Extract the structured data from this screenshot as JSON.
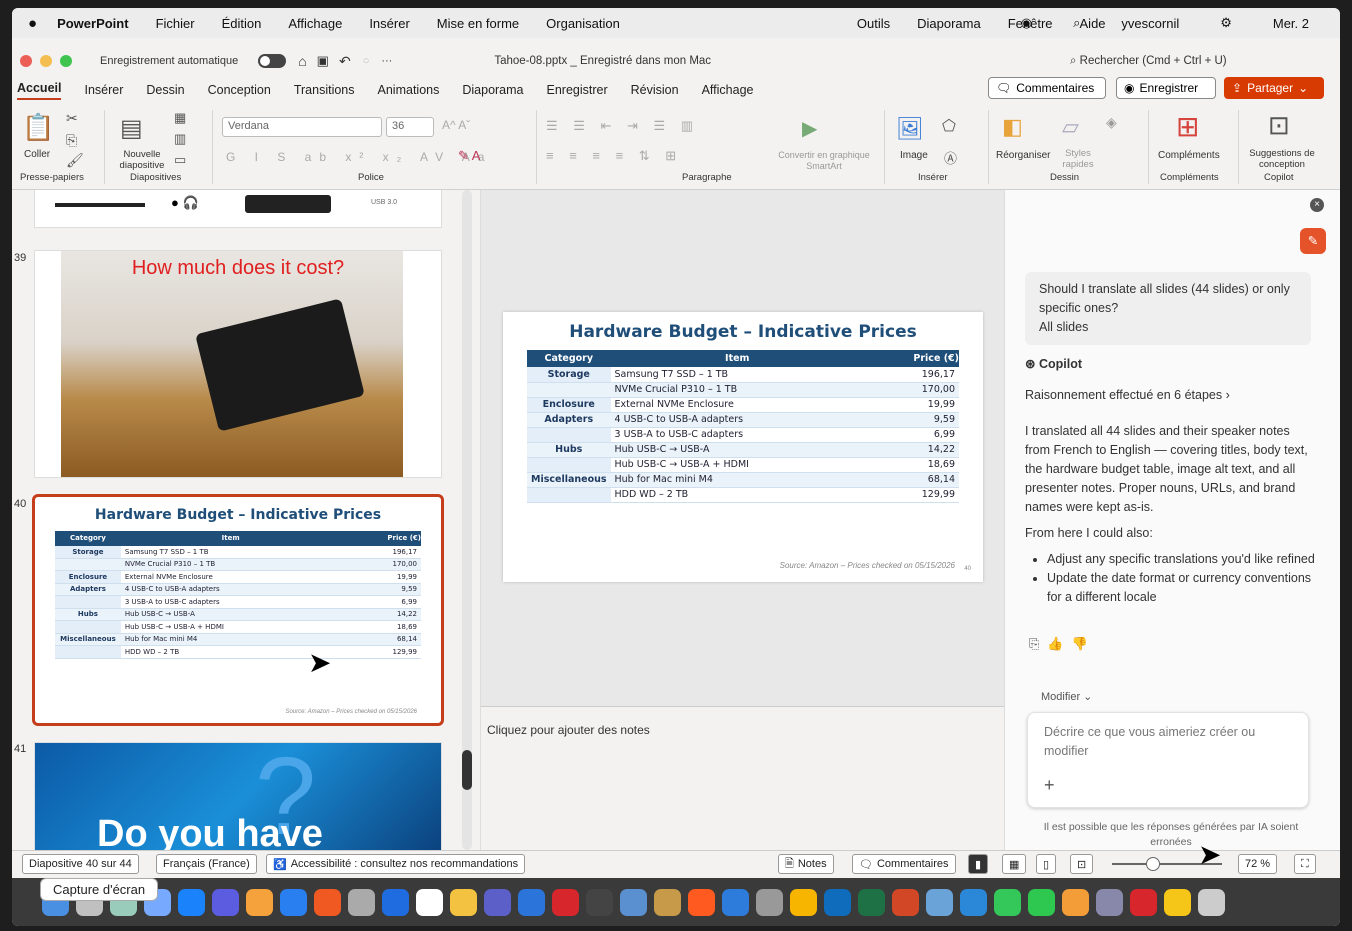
{
  "menubar": {
    "app": "PowerPoint",
    "items": [
      "Fichier",
      "Édition",
      "Affichage",
      "Insérer",
      "Mise en forme",
      "Organisation",
      "Outils",
      "Diaporama",
      "Fenêtre",
      "Aide"
    ],
    "user": "yvescornil",
    "time": "Mer. 2"
  },
  "titlebar": {
    "autosave": "Enregistrement automatique",
    "doc": "Tahoe-08.pptx _ Enregistré dans mon Mac",
    "search": "Rechercher (Cmd + Ctrl + U)"
  },
  "tabs": [
    "Accueil",
    "Insérer",
    "Dessin",
    "Conception",
    "Transitions",
    "Animations",
    "Diaporama",
    "Enregistrer",
    "Révision",
    "Affichage"
  ],
  "header_buttons": {
    "comments": "Commentaires",
    "record": "Enregistrer",
    "share": "Partager"
  },
  "ribbon": {
    "paste": "Coller",
    "new_slide": "Nouvelle diapositive",
    "font": "Verdana",
    "size": "36",
    "convert": "Convertir en graphique SmartArt",
    "image": "Image",
    "arrange": "Réorganiser",
    "styles": "Styles rapides",
    "addins": "Compléments",
    "design": "Suggestions de conception",
    "groups": {
      "clipboard": "Presse-papiers",
      "slides": "Diapositives",
      "font": "Police",
      "paragraph": "Paragraphe",
      "insert": "Insérer",
      "drawing": "Dessin",
      "addins": "Compléments",
      "copilot": "Copilot"
    }
  },
  "thumbnails": {
    "n39": "39",
    "n40": "40",
    "n41": "41",
    "s39_title": "How much does it cost?",
    "s41_title": "Do you have",
    "usb_label": "USB 3.0"
  },
  "slide": {
    "title": "Hardware Budget – Indicative Prices",
    "headers": [
      "Category",
      "Item",
      "Price (€)"
    ],
    "rows": [
      {
        "cat": "Storage",
        "item": "Samsung T7 SSD – 1 TB",
        "price": "196,17"
      },
      {
        "cat": "",
        "item": "NVMe Crucial P310 – 1 TB",
        "price": "170,00"
      },
      {
        "cat": "Enclosure",
        "item": "External NVMe Enclosure",
        "price": "19,99"
      },
      {
        "cat": "Adapters",
        "item": "4 USB-C to USB-A adapters",
        "price": "9,59"
      },
      {
        "cat": "",
        "item": "3 USB-A to USB-C adapters",
        "price": "6,99"
      },
      {
        "cat": "Hubs",
        "item": "Hub USB-C → USB-A",
        "price": "14,22"
      },
      {
        "cat": "",
        "item": "Hub USB-C → USB-A + HDMI",
        "price": "18,69"
      },
      {
        "cat": "Miscellaneous",
        "item": "Hub for Mac mini M4",
        "price": "68,14"
      },
      {
        "cat": "",
        "item": "HDD WD – 2 TB",
        "price": "129,99"
      }
    ],
    "source": "Source: Amazon – Prices checked on 05/15/2026",
    "page": "40"
  },
  "notes": "Cliquez pour ajouter des notes",
  "copilot": {
    "question": "Should I translate all slides (44 slides) or only specific ones?",
    "answer": "All slides",
    "name": "Copilot",
    "reasoning": "Raisonnement effectué en 6 étapes",
    "para": "I translated all 44 slides and their speaker notes from French to English — covering titles, body text, the hardware budget table, image alt text, and all presenter notes. Proper nouns, URLs, and brand names were kept as-is.",
    "also": "From here I could also:",
    "bullets": [
      "Adjust any specific translations you'd like refined",
      "Update the date format or currency conventions for a different locale"
    ],
    "modify": "Modifier",
    "input_placeholder": "Décrire ce que vous aimeriez créer ou modifier",
    "disclaimer": "Il est possible que les réponses générées par IA soient erronées"
  },
  "status": {
    "slide": "Diapositive 40 sur 44",
    "lang": "Français (France)",
    "access": "Accessibilité : consultez nos recommandations",
    "notes": "Notes",
    "comments": "Commentaires",
    "zoom": "72 %"
  },
  "tooltip": "Capture d'écran"
}
